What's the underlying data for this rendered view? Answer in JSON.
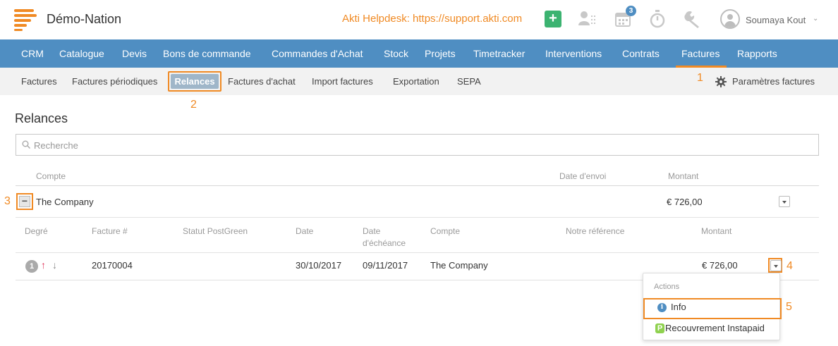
{
  "app": {
    "brand": "Démo-Nation",
    "helpdesk": "Akti Helpdesk: https://support.akti.com",
    "plus_label": "+",
    "calendar_badge": "3",
    "user_name": "Soumaya Kout",
    "user_chevron": "⌄"
  },
  "main_nav": [
    "CRM",
    "Catalogue",
    "Devis",
    "Bons de commande",
    "Commandes d'Achat",
    "Stock",
    "Projets",
    "Timetracker",
    "Interventions",
    "Contrats",
    "Factures",
    "Rapports"
  ],
  "main_nav_active": "Factures",
  "sub_nav": [
    "Factures",
    "Factures périodiques",
    "Relances",
    "Factures d'achat",
    "Import factures",
    "Exportation",
    "SEPA"
  ],
  "sub_nav_active": "Relances",
  "settings_label": "Paramètres factures",
  "annotations": [
    "1",
    "2",
    "3",
    "4",
    "5"
  ],
  "page": {
    "title": "Relances",
    "search_placeholder": "Recherche"
  },
  "summary_table": {
    "headers": [
      "Compte",
      "Date d'envoi",
      "Montant"
    ],
    "row": {
      "toggle": "−",
      "compte": "The Company",
      "montant": "€ 726,00"
    }
  },
  "detail_table": {
    "headers": [
      "Degré",
      "Facture #",
      "Statut PostGreen",
      "Date",
      "Date",
      "d'échéance",
      "Compte",
      "Notre référence",
      "Montant"
    ],
    "row": {
      "degre": "1",
      "facture": "20170004",
      "statut": "",
      "date": "30/10/2017",
      "echeance": "09/11/2017",
      "compte": "The Company",
      "reference": "",
      "montant": "€ 726,00"
    }
  },
  "actions_menu": {
    "header": "Actions",
    "info_label": "Info",
    "recouvrement_label": "Recouvrement Instapaid",
    "info_glyph": "i",
    "instapaid_glyph": "P"
  },
  "colors": {
    "accent": "#f08a24",
    "nav_bg": "#4f8ec2",
    "subnav_bg": "#f2f2f2",
    "add_button": "#3cb371",
    "arrow_up": "#e0335a",
    "instapaid": "#8fd14f"
  },
  "icons": [
    "logo-icon",
    "add-icon",
    "contacts-icon",
    "calendar-icon",
    "timer-icon",
    "wrench-icon",
    "avatar-icon",
    "gear-icon",
    "search-icon",
    "arrow-up-icon",
    "arrow-down-icon",
    "info-icon",
    "instapaid-icon"
  ]
}
